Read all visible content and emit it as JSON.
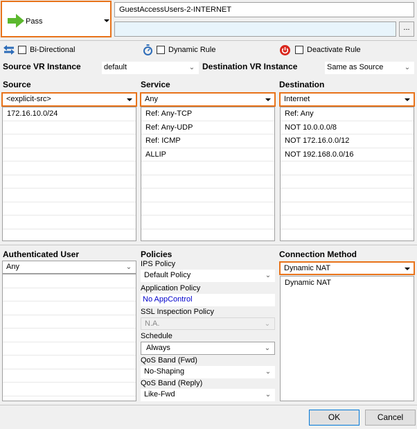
{
  "action": {
    "label": "Pass"
  },
  "rule_name": "GuestAccessUsers-2-INTERNET",
  "description": "",
  "more_button": "...",
  "options": {
    "bidirectional": "Bi-Directional",
    "dynamic_rule": "Dynamic Rule",
    "deactivate_rule": "Deactivate Rule"
  },
  "vr": {
    "source_label": "Source VR Instance",
    "source_value": "default",
    "destination_label": "Destination VR Instance",
    "destination_value": "Same as Source"
  },
  "source": {
    "heading": "Source",
    "selected": "<explicit-src>",
    "items": [
      "172.16.10.0/24",
      "",
      "",
      "",
      "",
      "",
      "",
      "",
      "",
      ""
    ]
  },
  "service": {
    "heading": "Service",
    "selected": "Any",
    "items": [
      "Ref: Any-TCP",
      "Ref: Any-UDP",
      "Ref: ICMP",
      "ALLIP",
      "",
      "",
      "",
      "",
      "",
      ""
    ]
  },
  "destination": {
    "heading": "Destination",
    "selected": "Internet",
    "items": [
      "Ref: Any",
      "NOT 10.0.0.0/8",
      "NOT 172.16.0.0/12",
      "NOT 192.168.0.0/16",
      "",
      "",
      "",
      "",
      "",
      ""
    ]
  },
  "auth_user": {
    "heading": "Authenticated User",
    "selected": "Any",
    "items": [
      "",
      "",
      "",
      "",
      "",
      "",
      "",
      "",
      "",
      ""
    ]
  },
  "policies": {
    "heading": "Policies",
    "ips_label": "IPS Policy",
    "ips_value": "Default Policy",
    "app_label": "Application Policy",
    "app_value": "No AppControl",
    "ssl_label": "SSL Inspection Policy",
    "ssl_value": "N.A.",
    "schedule_label": "Schedule",
    "schedule_value": "Always",
    "qos_fwd_label": "QoS Band (Fwd)",
    "qos_fwd_value": "No-Shaping",
    "qos_reply_label": "QoS Band (Reply)",
    "qos_reply_value": "Like-Fwd"
  },
  "connection": {
    "heading": "Connection Method",
    "selected": "Dynamic NAT",
    "items": [
      "Dynamic NAT"
    ]
  },
  "buttons": {
    "ok": "OK",
    "cancel": "Cancel"
  },
  "colors": {
    "accent": "#e8731a",
    "link": "#0000cc",
    "pass_arrow": "#5cb82e"
  }
}
